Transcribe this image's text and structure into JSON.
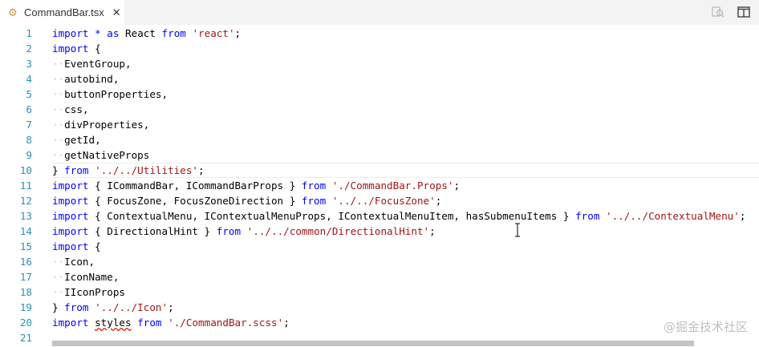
{
  "tab": {
    "filename": "CommandBar.tsx",
    "close_glyph": "✕",
    "icon": "gear-file-icon"
  },
  "actions": [
    {
      "name": "open-changes-icon",
      "label": "Open Changes"
    },
    {
      "name": "split-editor-icon",
      "label": "Split Editor"
    }
  ],
  "colors": {
    "keyword": "#0000ff",
    "string": "#a31515",
    "line_number": "#2b91af",
    "whitespace": "#c9c9c9"
  },
  "current_line": 10,
  "lines": [
    [
      [
        "kw",
        "import"
      ],
      [
        "t",
        " "
      ],
      [
        "kw",
        "*"
      ],
      [
        "t",
        " "
      ],
      [
        "kw",
        "as"
      ],
      [
        "t",
        " React "
      ],
      [
        "kw",
        "from"
      ],
      [
        "t",
        " "
      ],
      [
        "st",
        "'react'"
      ],
      [
        "t",
        ";"
      ]
    ],
    [
      [
        "kw",
        "import"
      ],
      [
        "t",
        " {"
      ]
    ],
    [
      [
        "ws",
        "··"
      ],
      [
        "t",
        "EventGroup,"
      ]
    ],
    [
      [
        "ws",
        "··"
      ],
      [
        "t",
        "autobind,"
      ]
    ],
    [
      [
        "ws",
        "··"
      ],
      [
        "t",
        "buttonProperties,"
      ]
    ],
    [
      [
        "ws",
        "··"
      ],
      [
        "t",
        "css,"
      ]
    ],
    [
      [
        "ws",
        "··"
      ],
      [
        "t",
        "divProperties,"
      ]
    ],
    [
      [
        "ws",
        "··"
      ],
      [
        "t",
        "getId,"
      ]
    ],
    [
      [
        "ws",
        "··"
      ],
      [
        "t",
        "getNativeProps"
      ]
    ],
    [
      [
        "t",
        "} "
      ],
      [
        "kw",
        "from"
      ],
      [
        "t",
        " "
      ],
      [
        "st",
        "'../../Utilities'"
      ],
      [
        "t",
        ";"
      ]
    ],
    [
      [
        "kw",
        "import"
      ],
      [
        "t",
        " { ICommandBar, ICommandBarProps } "
      ],
      [
        "kw",
        "from"
      ],
      [
        "t",
        " "
      ],
      [
        "st",
        "'./CommandBar.Props'"
      ],
      [
        "t",
        ";"
      ]
    ],
    [
      [
        "kw",
        "import"
      ],
      [
        "t",
        " { FocusZone, FocusZoneDirection } "
      ],
      [
        "kw",
        "from"
      ],
      [
        "t",
        " "
      ],
      [
        "st",
        "'../../FocusZone'"
      ],
      [
        "t",
        ";"
      ]
    ],
    [
      [
        "kw",
        "import"
      ],
      [
        "t",
        " { ContextualMenu, IContextualMenuProps, IContextualMenuItem, hasSubmenuItems } "
      ],
      [
        "kw",
        "from"
      ],
      [
        "t",
        " "
      ],
      [
        "st",
        "'../../ContextualMenu'"
      ],
      [
        "t",
        ";"
      ]
    ],
    [
      [
        "kw",
        "import"
      ],
      [
        "t",
        " { DirectionalHint } "
      ],
      [
        "kw",
        "from"
      ],
      [
        "t",
        " "
      ],
      [
        "st",
        "'../../common/DirectionalHint'"
      ],
      [
        "t",
        ";"
      ]
    ],
    [
      [
        "kw",
        "import"
      ],
      [
        "t",
        " {"
      ]
    ],
    [
      [
        "ws",
        "··"
      ],
      [
        "t",
        "Icon,"
      ]
    ],
    [
      [
        "ws",
        "··"
      ],
      [
        "t",
        "IconName,"
      ]
    ],
    [
      [
        "ws",
        "··"
      ],
      [
        "t",
        "IIconProps"
      ]
    ],
    [
      [
        "t",
        "} "
      ],
      [
        "kw",
        "from"
      ],
      [
        "t",
        " "
      ],
      [
        "st",
        "'../../Icon'"
      ],
      [
        "t",
        ";"
      ]
    ],
    [
      [
        "kw",
        "import"
      ],
      [
        "t",
        " "
      ],
      [
        "err",
        "styles"
      ],
      [
        "t",
        " "
      ],
      [
        "kw",
        "from"
      ],
      [
        "t",
        " "
      ],
      [
        "st",
        "'./CommandBar.scss'"
      ],
      [
        "t",
        ";"
      ]
    ],
    []
  ],
  "watermark": "@掘金技术社区"
}
